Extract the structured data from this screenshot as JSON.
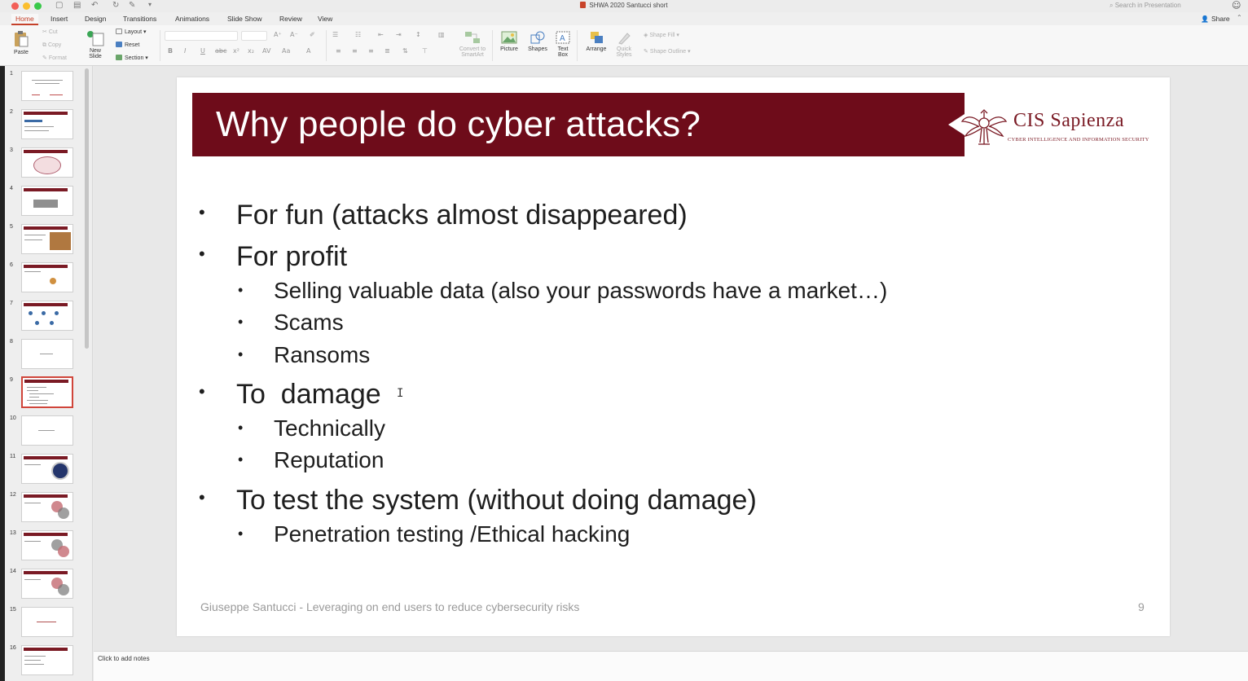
{
  "window": {
    "doc_title": "SHWA 2020 Santucci short",
    "search_placeholder": "Search in Presentation"
  },
  "tabs": [
    "Home",
    "Insert",
    "Design",
    "Transitions",
    "Animations",
    "Slide Show",
    "Review",
    "View"
  ],
  "active_tab": "Home",
  "share_label": "Share",
  "ribbon": {
    "paste": "Paste",
    "cut": "Cut",
    "copy": "Copy",
    "format": "Format",
    "new_slide_1": "New",
    "new_slide_2": "Slide",
    "layout": "Layout",
    "reset": "Reset",
    "section": "Section",
    "convert_1": "Convert to",
    "convert_2": "SmartArt",
    "picture": "Picture",
    "shapes": "Shapes",
    "textbox_1": "Text",
    "textbox_2": "Box",
    "arrange": "Arrange",
    "quick_styles_1": "Quick",
    "quick_styles_2": "Styles",
    "shape_fill": "Shape Fill",
    "shape_outline": "Shape Outline"
  },
  "slide_numbers": [
    "1",
    "2",
    "3",
    "4",
    "5",
    "6",
    "7",
    "8",
    "9",
    "10",
    "11",
    "12",
    "13",
    "14",
    "15",
    "16"
  ],
  "selected_slide": "9",
  "slide": {
    "title": "Why people do cyber attacks?",
    "logo_name": "CIS Sapienza",
    "logo_sub": "Cyber Intelligence and Information Security",
    "bullets": [
      {
        "level": 1,
        "text": "For fun (attacks almost disappeared)"
      },
      {
        "level": 1,
        "text": "For profit"
      },
      {
        "level": 2,
        "text": "Selling valuable data (also your passwords have a market…)"
      },
      {
        "level": 2,
        "text": "Scams"
      },
      {
        "level": 2,
        "text": "Ransoms"
      },
      {
        "level": 1,
        "text": "To  damage"
      },
      {
        "level": 2,
        "text": "Technically"
      },
      {
        "level": 2,
        "text": "Reputation"
      },
      {
        "level": 1,
        "text": "To test the system (without doing damage)"
      },
      {
        "level": 2,
        "text": "Penetration testing /Ethical hacking"
      }
    ],
    "footer": "Giuseppe Santucci - Leveraging on end users to reduce cybersecurity risks",
    "page_number": "9"
  },
  "notes_placeholder": "Click to add notes",
  "colors": {
    "title_band": "#6e0c1a",
    "accent": "#c5412a"
  }
}
